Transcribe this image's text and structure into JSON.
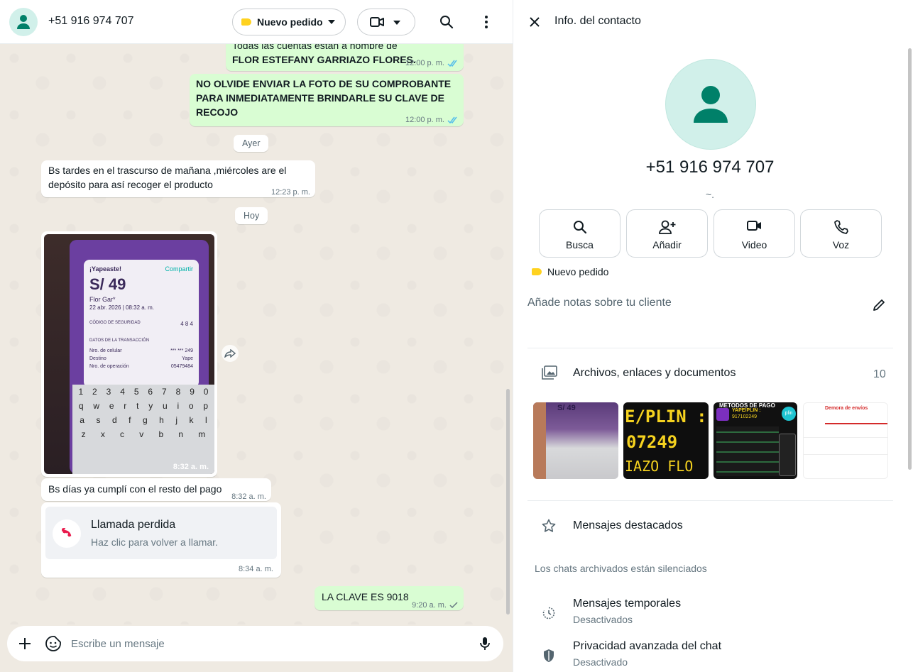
{
  "chat": {
    "contact_name": "+51 916 974 707",
    "label_chip": "Nuevo pedido",
    "composer_placeholder": "Escribe un mensaje",
    "messages": {
      "m1_line1": "Todas las cuentas están a nombre de",
      "m1_line2": "FLOR ESTEFANY GARRIAZO FLORES.",
      "m1_time": "12:00 p. m.",
      "m2_line1": "NO OLVIDE ENVIAR LA FOTO DE SU COMPROBANTE",
      "m2_line2": "PARA INMEDIATAMENTE BRINDARLE SU CLAVE DE",
      "m2_line3": "RECOJO",
      "m2_time": "12:00 p. m.",
      "day_yesterday": "Ayer",
      "m3_line1": "Bs tardes en el trascurso de mañana ,miércoles are el",
      "m3_line2": "depósito para así recoger el producto",
      "m3_time": "12:23 p. m.",
      "day_today": "Hoy",
      "img_time": "8:32 a. m.",
      "img_yape_title": "¡Yapeaste!",
      "img_yape_share": "Compartir",
      "img_yape_amount": "S/ 49",
      "img_yape_name": "Flor Gar*",
      "img_yape_date": "22 abr. 2026  |  08:32 a. m.",
      "img_yape_sec": "CÓDIGO DE SEGURIDAD",
      "img_yape_code": "4  8  4",
      "img_yape_data": "DATOS DE LA TRANSACCIÓN",
      "img_yape_r1k": "Nro. de celular",
      "img_yape_r1v": "*** *** 249",
      "img_yape_r2k": "Destino",
      "img_yape_r2v": "Yape",
      "img_yape_r3k": "Nro. de operación",
      "img_yape_r3v": "05479484",
      "kb_row1": [
        "1",
        "2",
        "3",
        "4",
        "5",
        "6",
        "7",
        "8",
        "9",
        "0"
      ],
      "kb_row2": [
        "q",
        "w",
        "e",
        "r",
        "t",
        "y",
        "u",
        "i",
        "o",
        "p"
      ],
      "kb_row3": [
        "a",
        "s",
        "d",
        "f",
        "g",
        "h",
        "j",
        "k",
        "l"
      ],
      "kb_row4": [
        "z",
        "x",
        "c",
        "v",
        "b",
        "n",
        "m"
      ],
      "m4_text": "Bs días ya cumplí  con el resto del pago",
      "m4_time": "8:32 a. m.",
      "call_title": "Llamada perdida",
      "call_sub": "Haz clic para volver a llamar.",
      "call_time": "8:34 a. m.",
      "m5_text": "LA CLAVE ES 9018",
      "m5_time": "9:20 a. m."
    }
  },
  "info": {
    "title": "Info. del contacto",
    "phone": "+51 916 974 707",
    "about": "~.",
    "actions": {
      "search": "Busca",
      "add": "Añadir",
      "video": "Video",
      "voice": "Voz"
    },
    "label": "Nuevo pedido",
    "notes_placeholder": "Añade notas sobre tu cliente",
    "media_title": "Archivos, enlaces y documentos",
    "media_count": "10",
    "thumb2_line1": "E/PLIN :",
    "thumb2_line2": "07249",
    "thumb2_line3": "IAZO FLO",
    "thumb3_title": "METODOS DE PAGO",
    "thumb3_sub": "YAPE/PLIN :",
    "thumb3_num": "917102249",
    "thumb3_brand": "plin",
    "thumb4_title": "Demora de envíos",
    "thumb1_amount": "S/ 49",
    "starred": "Mensajes destacados",
    "archived_note": "Los chats archivados están silenciados",
    "temp_title": "Mensajes temporales",
    "temp_sub": "Desactivados",
    "privacy_title": "Privacidad avanzada del chat",
    "privacy_sub": "Desactivado"
  },
  "colors": {
    "label_yellow": "#ffd21f",
    "outgoing_bubble": "#d9fdd3",
    "read_ticks": "#53bdeb",
    "missed_call_red": "#e9194b",
    "avatar_green": "#008069"
  },
  "icons": [
    "person-icon",
    "tag-icon",
    "caret-down-icon",
    "video-icon",
    "search-icon",
    "menu-icon",
    "forward-icon",
    "missed-call-icon",
    "plus-icon",
    "sticker-icon",
    "mic-icon",
    "close-icon",
    "add-person-icon",
    "phone-icon",
    "edit-icon",
    "media-icon",
    "star-icon",
    "timer-icon",
    "shield-icon",
    "double-check-icon",
    "check-icon"
  ]
}
